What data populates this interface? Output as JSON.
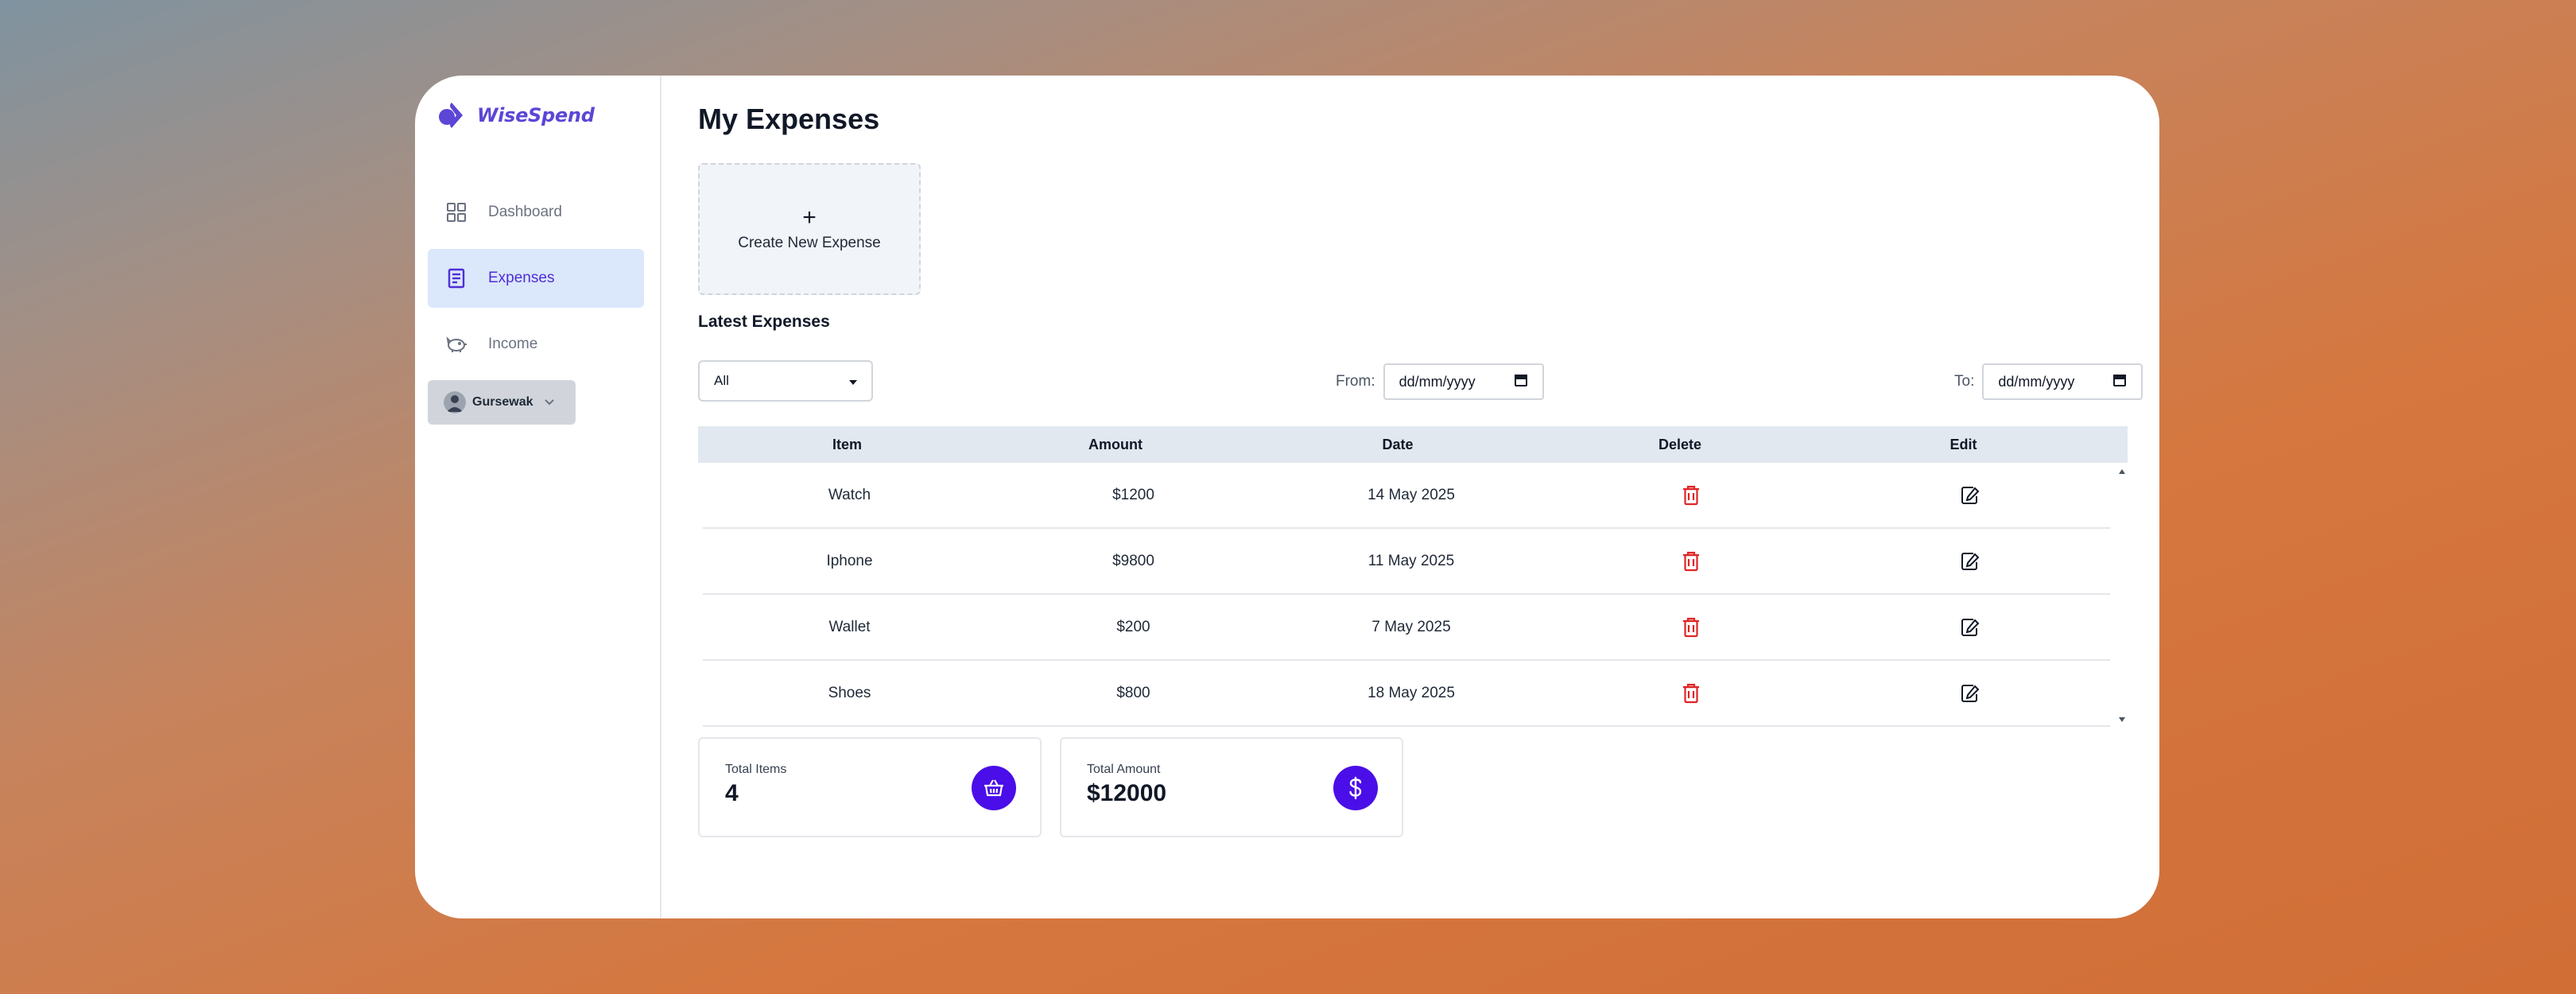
{
  "app": {
    "brand": "WiseSpend",
    "accent_color": "#4a0ee8",
    "brand_color": "#5b46d6"
  },
  "sidebar": {
    "items": [
      {
        "label": "Dashboard",
        "icon": "grid-icon",
        "active": false
      },
      {
        "label": "Expenses",
        "icon": "document-icon",
        "active": true
      },
      {
        "label": "Income",
        "icon": "piggy-bank-icon",
        "active": false
      }
    ],
    "user": {
      "name": "Gursewak",
      "icon": "chevron-down-icon"
    }
  },
  "main": {
    "title": "My Expenses",
    "create_button": {
      "symbol": "+",
      "label": "Create New Expense"
    },
    "section_title": "Latest Expenses",
    "filter": {
      "selected": "All"
    },
    "from": {
      "label": "From:",
      "placeholder": "dd/mm/yyyy"
    },
    "to": {
      "label": "To:",
      "placeholder": "dd/mm/yyyy"
    },
    "table": {
      "headers": [
        "Item",
        "Amount",
        "Date",
        "Delete",
        "Edit"
      ],
      "rows": [
        {
          "item": "Watch",
          "amount": "$1200",
          "date": "14 May 2025"
        },
        {
          "item": "Iphone",
          "amount": "$9800",
          "date": "11 May 2025"
        },
        {
          "item": "Wallet",
          "amount": "$200",
          "date": "7 May 2025"
        },
        {
          "item": "Shoes",
          "amount": "$800",
          "date": "18 May 2025"
        }
      ],
      "delete_icon": "trash-icon",
      "edit_icon": "edit-icon",
      "delete_color": "#e02424"
    },
    "stats": {
      "total_items": {
        "label": "Total Items",
        "value": "4",
        "icon": "basket-icon"
      },
      "total_amount": {
        "label": "Total Amount",
        "value": "$12000",
        "icon": "dollar-icon"
      }
    }
  }
}
